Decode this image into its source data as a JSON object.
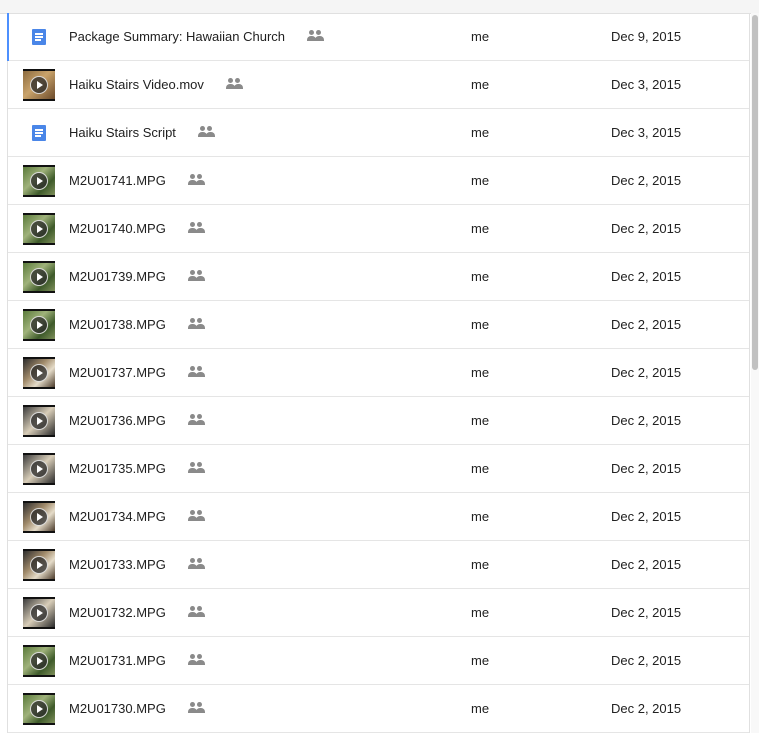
{
  "files": [
    {
      "name": "Package Summary: Hawaiian Church",
      "type": "doc",
      "owner": "me",
      "modified": "Dec 9, 2015",
      "thumb": "",
      "selected": true
    },
    {
      "name": "Haiku Stairs Video.mov",
      "type": "video",
      "owner": "me",
      "modified": "Dec 3, 2015",
      "thumb": "brown"
    },
    {
      "name": "Haiku Stairs Script",
      "type": "doc",
      "owner": "me",
      "modified": "Dec 3, 2015",
      "thumb": ""
    },
    {
      "name": "M2U01741.MPG",
      "type": "video",
      "owner": "me",
      "modified": "Dec 2, 2015",
      "thumb": "green"
    },
    {
      "name": "M2U01740.MPG",
      "type": "video",
      "owner": "me",
      "modified": "Dec 2, 2015",
      "thumb": "green"
    },
    {
      "name": "M2U01739.MPG",
      "type": "video",
      "owner": "me",
      "modified": "Dec 2, 2015",
      "thumb": "green"
    },
    {
      "name": "M2U01738.MPG",
      "type": "video",
      "owner": "me",
      "modified": "Dec 2, 2015",
      "thumb": "green"
    },
    {
      "name": "M2U01737.MPG",
      "type": "video",
      "owner": "me",
      "modified": "Dec 2, 2015",
      "thumb": "mixed"
    },
    {
      "name": "M2U01736.MPG",
      "type": "video",
      "owner": "me",
      "modified": "Dec 2, 2015",
      "thumb": "dark"
    },
    {
      "name": "M2U01735.MPG",
      "type": "video",
      "owner": "me",
      "modified": "Dec 2, 2015",
      "thumb": "dark"
    },
    {
      "name": "M2U01734.MPG",
      "type": "video",
      "owner": "me",
      "modified": "Dec 2, 2015",
      "thumb": "mixed"
    },
    {
      "name": "M2U01733.MPG",
      "type": "video",
      "owner": "me",
      "modified": "Dec 2, 2015",
      "thumb": "mixed"
    },
    {
      "name": "M2U01732.MPG",
      "type": "video",
      "owner": "me",
      "modified": "Dec 2, 2015",
      "thumb": "dark"
    },
    {
      "name": "M2U01731.MPG",
      "type": "video",
      "owner": "me",
      "modified": "Dec 2, 2015",
      "thumb": "green"
    },
    {
      "name": "M2U01730.MPG",
      "type": "video",
      "owner": "me",
      "modified": "Dec 2, 2015",
      "thumb": "green"
    }
  ],
  "icons": {
    "doc": "google-doc-icon",
    "video": "video-thumbnail",
    "shared": "shared-people-icon"
  },
  "colors": {
    "doc_blue": "#4a86e8",
    "selection_accent": "#4d90fe",
    "shared_icon_gray": "#8a8a8a"
  }
}
